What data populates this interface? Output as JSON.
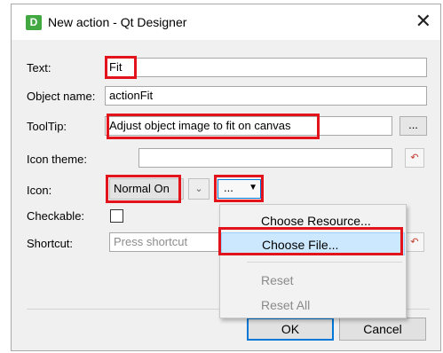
{
  "window": {
    "app_icon_letter": "D",
    "title": "New action - Qt Designer",
    "close_glyph": "✕"
  },
  "form": {
    "text": {
      "label": "Text:",
      "value": "Fit"
    },
    "object_name": {
      "label": "Object name:",
      "value": "actionFit"
    },
    "tooltip": {
      "label": "ToolTip:",
      "value": "Adjust object image to fit on canvas",
      "browse_label": "..."
    },
    "icon_theme": {
      "label": "Icon theme:",
      "value": ""
    },
    "icon": {
      "label": "Icon:",
      "mode_value": "Normal On",
      "browse_label": "...",
      "arrow_glyph": "▼"
    },
    "checkable": {
      "label": "Checkable:",
      "checked": false
    },
    "shortcut": {
      "label": "Shortcut:",
      "placeholder": "Press shortcut"
    },
    "reset_glyph": "↶"
  },
  "dropdown_menu": {
    "items": [
      {
        "label": "Choose Resource...",
        "enabled": true
      },
      {
        "label": "Choose File...",
        "enabled": true,
        "active": true
      },
      {
        "label": "Reset",
        "enabled": false
      },
      {
        "label": "Reset All",
        "enabled": false
      }
    ]
  },
  "buttons": {
    "ok_label": "OK",
    "cancel_label": "Cancel"
  },
  "colors": {
    "highlight": "#e2131a",
    "menu_active": "#cce8ff",
    "app_icon": "#42a942"
  }
}
